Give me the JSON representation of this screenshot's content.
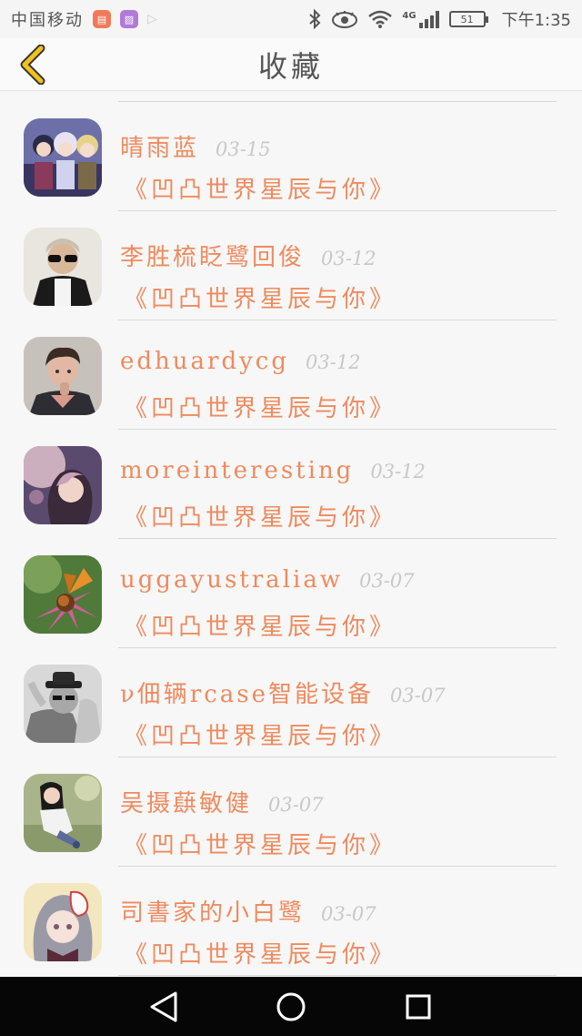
{
  "status_bar": {
    "carrier": "中国移动",
    "battery": "51",
    "time": "下午1:35",
    "network": "4G",
    "icons": [
      "app-red-icon",
      "app-purple-icon",
      "play-icon",
      "bluetooth-icon",
      "eye-icon",
      "wifi-icon",
      "signal-icon",
      "battery-icon"
    ]
  },
  "header": {
    "title": "收藏",
    "back_icon": "chevron-left-icon"
  },
  "colors": {
    "accent": "#ee8a5e",
    "back": "#f2c21b",
    "date": "#c8c8c8"
  },
  "favorites": [
    {
      "name": "晴雨蓝",
      "date": "03-15",
      "book": "《凹凸世界星辰与你》",
      "avatar": "anime-group-avatar"
    },
    {
      "name": "李胜梳眨鹭回俊",
      "date": "03-12",
      "book": "《凹凸世界星辰与你》",
      "avatar": "sunglasses-man-avatar"
    },
    {
      "name": "edhuardycg",
      "date": "03-12",
      "book": "《凹凸世界星辰与你》",
      "avatar": "young-man-avatar"
    },
    {
      "name": "moreinteresting",
      "date": "03-12",
      "book": "《凹凸世界星辰与你》",
      "avatar": "fantasy-girl-avatar"
    },
    {
      "name": "uggayustraliaw",
      "date": "03-07",
      "book": "《凹凸世界星辰与你》",
      "avatar": "butterfly-flower-avatar"
    },
    {
      "name": "ν佃辆rcase智能设备",
      "date": "03-07",
      "book": "《凹凸世界星辰与你》",
      "avatar": "hat-man-avatar"
    },
    {
      "name": "吴摄蕻敏健",
      "date": "03-07",
      "book": "《凹凸世界星辰与你》",
      "avatar": "girl-outdoor-avatar"
    },
    {
      "name": "司書家的小白鹭",
      "date": "03-07",
      "book": "《凹凸世界星辰与你》",
      "avatar": "masked-anime-girl-avatar"
    }
  ],
  "nav": {
    "icons": [
      "back-triangle-icon",
      "home-circle-icon",
      "recents-square-icon"
    ]
  }
}
